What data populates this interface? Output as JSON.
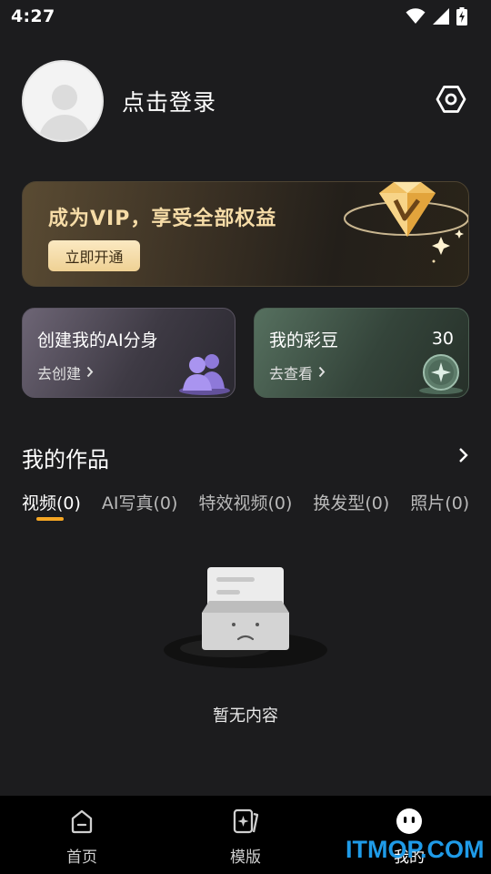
{
  "status_bar": {
    "time": "4:27",
    "icons": [
      "wifi-icon",
      "signal-icon",
      "battery-charging-icon"
    ]
  },
  "profile": {
    "login_label": "点击登录",
    "settings_icon": "settings-hexagon-icon"
  },
  "vip_banner": {
    "title": "成为VIP，享受全部权益",
    "button_label": "立即开通",
    "icon": "vip-diamond-icon",
    "accent": "#f6dca7"
  },
  "cards": {
    "ai_avatar": {
      "title": "创建我的AI分身",
      "action": "去创建",
      "icon": "ai-avatar-figures-icon"
    },
    "beans": {
      "title": "我的彩豆",
      "count": "30",
      "action": "去查看",
      "icon": "bean-coin-icon"
    }
  },
  "works": {
    "title": "我的作品",
    "tabs": [
      {
        "label": "视频(0)",
        "active": true
      },
      {
        "label": "AI写真(0)",
        "active": false
      },
      {
        "label": "特效视频(0)",
        "active": false
      },
      {
        "label": "换发型(0)",
        "active": false
      },
      {
        "label": "照片(0)",
        "active": false
      }
    ],
    "tab_indicator_color": "#f5a623",
    "empty_text": "暂无内容"
  },
  "bottom_nav": [
    {
      "label": "首页",
      "icon": "home-icon",
      "active": false
    },
    {
      "label": "模版",
      "icon": "template-icon",
      "active": false
    },
    {
      "label": "我的",
      "icon": "profile-face-icon",
      "active": true
    }
  ],
  "watermark": "ITMOP.COM"
}
